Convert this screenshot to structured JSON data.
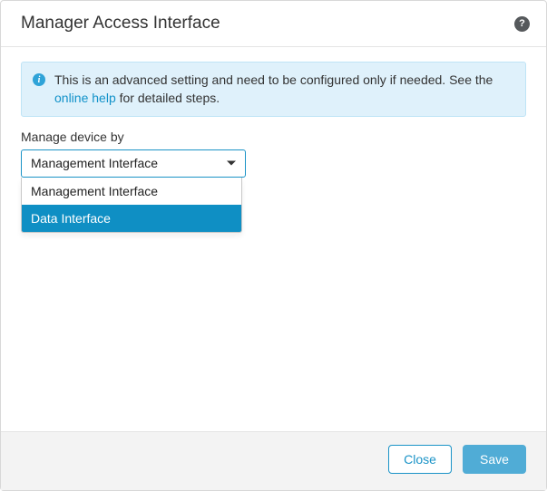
{
  "header": {
    "title": "Manager Access Interface",
    "help_tooltip": "?"
  },
  "banner": {
    "text_before_link": "This is an advanced setting and need to be configured only if needed. See the ",
    "link_text": "online help",
    "text_after_link": " for detailed steps."
  },
  "field": {
    "label": "Manage device by",
    "selected_value": "Management Interface",
    "options": [
      {
        "label": "Management Interface",
        "highlighted": false
      },
      {
        "label": "Data Interface",
        "highlighted": true
      }
    ]
  },
  "footer": {
    "close_label": "Close",
    "save_label": "Save"
  }
}
